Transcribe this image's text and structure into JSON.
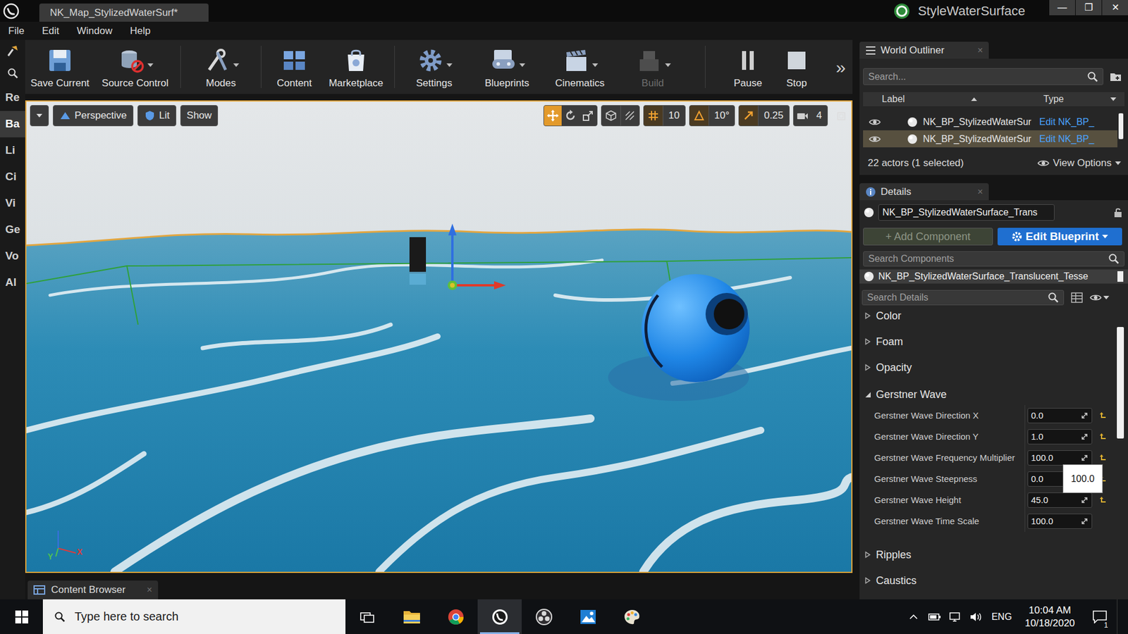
{
  "window": {
    "tab_title": "NK_Map_StylizedWaterSurf*",
    "project_name": "StyleWaterSurface",
    "controls": [
      "—",
      "❐",
      "✕"
    ]
  },
  "menu": [
    "File",
    "Edit",
    "Window",
    "Help"
  ],
  "mode_tabs": [
    {
      "label": "Re",
      "selected": false
    },
    {
      "label": "Ba",
      "selected": true
    },
    {
      "label": "Li",
      "selected": false
    },
    {
      "label": "Ci",
      "selected": false
    },
    {
      "label": "Vi",
      "selected": false
    },
    {
      "label": "Ge",
      "selected": false
    },
    {
      "label": "Vo",
      "selected": false
    },
    {
      "label": "Al",
      "selected": false
    }
  ],
  "toolbar": {
    "buttons": [
      {
        "label": "Save Current",
        "kind": "save",
        "dropdown": false,
        "disabled": false
      },
      {
        "label": "Source Control",
        "kind": "source",
        "dropdown": true,
        "disabled": false
      },
      {
        "label": "Modes",
        "kind": "modes",
        "dropdown": true,
        "disabled": false
      },
      {
        "label": "Content",
        "kind": "content",
        "dropdown": false,
        "disabled": false
      },
      {
        "label": "Marketplace",
        "kind": "marketplace",
        "dropdown": false,
        "disabled": false
      },
      {
        "label": "Settings",
        "kind": "settings",
        "dropdown": true,
        "disabled": false
      },
      {
        "label": "Blueprints",
        "kind": "blueprints",
        "dropdown": true,
        "disabled": false
      },
      {
        "label": "Cinematics",
        "kind": "cinematics",
        "dropdown": true,
        "disabled": false
      },
      {
        "label": "Build",
        "kind": "build",
        "dropdown": true,
        "disabled": true
      },
      {
        "label": "Pause",
        "kind": "pause",
        "dropdown": false,
        "disabled": false
      },
      {
        "label": "Stop",
        "kind": "stop",
        "dropdown": false,
        "disabled": false
      }
    ],
    "overflow": "»"
  },
  "viewport": {
    "view_mode": "Perspective",
    "lighting": "Lit",
    "show": "Show",
    "transform_tools": [
      {
        "kind": "translate",
        "selected": true
      },
      {
        "kind": "rotate",
        "selected": false
      },
      {
        "kind": "scale",
        "selected": false
      }
    ],
    "snaps": [
      {
        "kind": "grid",
        "value": "10",
        "on": true
      },
      {
        "kind": "rotation",
        "value": "10°",
        "on": true
      },
      {
        "kind": "scale",
        "value": "0.25",
        "on": true
      }
    ],
    "camera_speed": "4",
    "axis_labels": [
      {
        "label": "X",
        "color": "#e03a3a"
      },
      {
        "label": "Y",
        "color": "#4fc24f"
      }
    ]
  },
  "bottom_tabs": [
    {
      "label": "Content Browser",
      "close": "×",
      "selected": true
    }
  ],
  "outliner": {
    "title": "World Outliner",
    "close": "×",
    "search_placeholder": "Search...",
    "columns": [
      "Label",
      "Type"
    ],
    "rows": [
      {
        "label": "NK_BP_StylizedWaterSur",
        "type": "Edit NK_BP_",
        "selected": false
      },
      {
        "label": "NK_BP_StylizedWaterSur",
        "type": "Edit NK_BP_",
        "selected": true
      }
    ],
    "footer": "22 actors (1 selected)",
    "view_options": "View Options"
  },
  "details": {
    "title": "Details",
    "close": "×",
    "actor_name": "NK_BP_StylizedWaterSurface_Trans",
    "add_component": "+ Add Component",
    "add_component_disabled": true,
    "edit_blueprint": "Edit Blueprint",
    "search_components_placeholder": "Search Components",
    "component": {
      "label": "NK_BP_StylizedWaterSurface_Translucent_Tesse",
      "selected": true
    },
    "search_details_placeholder": "Search Details",
    "categories": [
      {
        "name": "Color",
        "expanded": false
      },
      {
        "name": "Foam",
        "expanded": false
      },
      {
        "name": "Opacity",
        "expanded": false
      },
      {
        "name": "Gerstner Wave",
        "expanded": true,
        "properties": [
          {
            "name": "Gerstner Wave Direction X",
            "value": "0.0",
            "modified": true
          },
          {
            "name": "Gerstner Wave Direction Y",
            "value": "1.0",
            "modified": true
          },
          {
            "name": "Gerstner Wave Frequency Multiplier",
            "value": "100.0",
            "modified": true
          },
          {
            "name": "Gerstner Wave Steepness",
            "value": "0.0",
            "modified": true,
            "tooltip": "100.0"
          },
          {
            "name": "Gerstner Wave Height",
            "value": "45.0",
            "modified": true
          },
          {
            "name": "Gerstner Wave Time Scale",
            "value": "100.0",
            "modified": false
          }
        ]
      },
      {
        "name": "Ripples",
        "expanded": false
      },
      {
        "name": "Caustics",
        "expanded": false
      }
    ]
  },
  "taskbar": {
    "search_placeholder": "Type here to search",
    "apps": [
      {
        "kind": "task-view",
        "active": false
      },
      {
        "kind": "explorer",
        "active": false
      },
      {
        "kind": "chrome",
        "active": false
      },
      {
        "kind": "unreal",
        "active": true
      },
      {
        "kind": "obs",
        "active": false
      },
      {
        "kind": "photos",
        "active": false
      },
      {
        "kind": "paint",
        "active": false
      }
    ],
    "language": "ENG",
    "time": "10:04 AM",
    "date": "10/18/2020",
    "notification_count": "1"
  }
}
